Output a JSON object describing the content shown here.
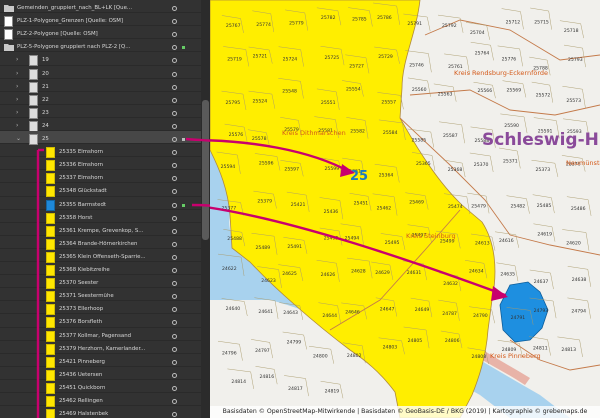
{
  "panel": {
    "rows": [
      {
        "label": "Gemeinden_gruppiert_nach_BL+LK [Que...",
        "indent": 0,
        "kind": "folder"
      },
      {
        "label": "PLZ-1-Polygone_Grenzen [Quelle: OSM]",
        "indent": 0,
        "kind": "white"
      },
      {
        "label": "PLZ-2-Polygone [Quelle: OSM]",
        "indent": 0,
        "kind": "white"
      },
      {
        "label": "PLZ-5-Polygone gruppiert nach PLZ-2 [Q...",
        "indent": 0,
        "kind": "folder"
      },
      {
        "label": "19",
        "indent": 1,
        "kind": "grey",
        "chev": "›"
      },
      {
        "label": "20",
        "indent": 1,
        "kind": "grey",
        "chev": "›"
      },
      {
        "label": "21",
        "indent": 1,
        "kind": "grey",
        "chev": "›"
      },
      {
        "label": "22",
        "indent": 1,
        "kind": "grey",
        "chev": "›"
      },
      {
        "label": "23",
        "indent": 1,
        "kind": "grey",
        "chev": "›"
      },
      {
        "label": "24",
        "indent": 1,
        "kind": "grey",
        "chev": "›"
      },
      {
        "label": "25",
        "indent": 1,
        "kind": "grey",
        "chev": "⌄",
        "selected": true
      },
      {
        "label": "25335 Elmshorn",
        "indent": 2,
        "kind": "yellow"
      },
      {
        "label": "25336 Elmshorn",
        "indent": 2,
        "kind": "yellow"
      },
      {
        "label": "25337 Elmshorn",
        "indent": 2,
        "kind": "yellow"
      },
      {
        "label": "25348 Glückstadt",
        "indent": 2,
        "kind": "yellow"
      },
      {
        "label": "25355 Barmstedt",
        "indent": 2,
        "kind": "blue"
      },
      {
        "label": "25358 Horst",
        "indent": 2,
        "kind": "yellow"
      },
      {
        "label": "25361 Krempe, Grevenkop, S...",
        "indent": 2,
        "kind": "yellow"
      },
      {
        "label": "25364 Brande-Hörnerkirchen",
        "indent": 2,
        "kind": "yellow"
      },
      {
        "label": "25365 Klein Offenseth-Sparrie...",
        "indent": 2,
        "kind": "yellow"
      },
      {
        "label": "25368 Kiebitzreihe",
        "indent": 2,
        "kind": "yellow"
      },
      {
        "label": "25370 Seester",
        "indent": 2,
        "kind": "yellow"
      },
      {
        "label": "25371 Seestermühe",
        "indent": 2,
        "kind": "yellow"
      },
      {
        "label": "25373 Ellerhoop",
        "indent": 2,
        "kind": "yellow"
      },
      {
        "label": "25376 Borsfleth",
        "indent": 2,
        "kind": "yellow"
      },
      {
        "label": "25377 Kollmar, Pagensand",
        "indent": 2,
        "kind": "yellow"
      },
      {
        "label": "25379 Herzhorn, Kamerlander...",
        "indent": 2,
        "kind": "yellow"
      },
      {
        "label": "25421 Pinneberg",
        "indent": 2,
        "kind": "yellow"
      },
      {
        "label": "25436 Uetersen",
        "indent": 2,
        "kind": "yellow"
      },
      {
        "label": "25451 Quickborn",
        "indent": 2,
        "kind": "yellow"
      },
      {
        "label": "25462 Rellingen",
        "indent": 2,
        "kind": "yellow"
      },
      {
        "label": "25469 Halstenbek",
        "indent": 2,
        "kind": "yellow"
      }
    ]
  },
  "map": {
    "region_labels": [
      {
        "text": "Kreis Dithmarschen",
        "color": "#d45a1a"
      },
      {
        "text": "Kreis Steinburg",
        "color": "#d45a1a"
      },
      {
        "text": "Kreis Pinneberg",
        "color": "#d45a1a"
      },
      {
        "text": "Kreis Rendsburg-Eckernförde",
        "color": "#d45a1a"
      },
      {
        "text": "Neumünster",
        "color": "#d45a1a"
      }
    ],
    "state_label": "Schleswig-H",
    "highlight_label": "25",
    "postcodes": [
      "25767",
      "25774",
      "25779",
      "25782",
      "25785",
      "25786",
      "25791",
      "25792",
      "25704",
      "25712",
      "25715",
      "25718",
      "25719",
      "25721",
      "25724",
      "25725",
      "25727",
      "25729",
      "25746",
      "25761",
      "25764",
      "25776",
      "25788",
      "25793",
      "25795",
      "25524",
      "25548",
      "25551",
      "25554",
      "25557",
      "25560",
      "25563",
      "25566",
      "25569",
      "25572",
      "25573",
      "25576",
      "25578",
      "25579",
      "25581",
      "25582",
      "25584",
      "25585",
      "25587",
      "25588",
      "25590",
      "25591",
      "25593",
      "25594",
      "25596",
      "25597",
      "25599",
      "25361",
      "25364",
      "25365",
      "25368",
      "25370",
      "25371",
      "25373",
      "25376",
      "25377",
      "25379",
      "25421",
      "25436",
      "25451",
      "25462",
      "25469",
      "25474",
      "25479",
      "25482",
      "25485",
      "25486",
      "25488",
      "25489",
      "25491",
      "25492",
      "25494",
      "25495",
      "25497",
      "25499",
      "24613",
      "24616",
      "24619",
      "24620",
      "24622",
      "24623",
      "24625",
      "24626",
      "24628",
      "24629",
      "24631",
      "24632",
      "24634",
      "24635",
      "24637",
      "24638",
      "24640",
      "24641",
      "24643",
      "24644",
      "24646",
      "24647",
      "24649",
      "24787",
      "24790",
      "24791",
      "24793",
      "24794",
      "24796",
      "24797",
      "24799",
      "24800",
      "24802",
      "24803",
      "24805",
      "24806",
      "24808",
      "24809",
      "24811",
      "24813",
      "24814",
      "24816",
      "24817",
      "24819"
    ],
    "colors": {
      "fill": "#ffee00",
      "highlight": "#1e8fe0",
      "arrow": "#c8006e",
      "water": "#a8d2ee",
      "land": "#f1f0ec",
      "border": "#c47a4a"
    }
  },
  "credits": "Basisdaten © OpenStreetMap-Mitwirkende  |  Basisdaten © GeoBasis-DE / BKG (2019)  |  Kartographie © grebemaps.de"
}
